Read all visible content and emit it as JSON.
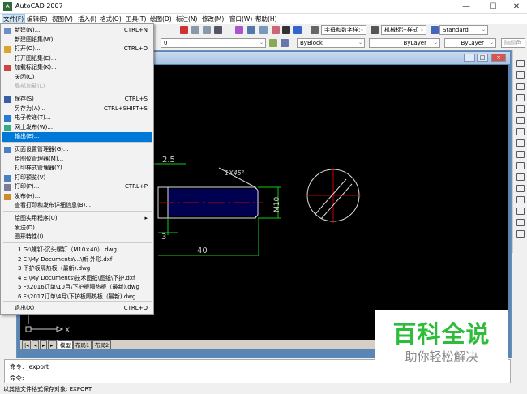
{
  "window": {
    "title": "AutoCAD 2007",
    "minimize": "—",
    "maximize": "☐",
    "close": "✕"
  },
  "menubar": [
    "文件(F)",
    "编辑(E)",
    "视图(V)",
    "插入(I)",
    "格式(O)",
    "工具(T)",
    "绘图(D)",
    "标注(N)",
    "修改(M)",
    "窗口(W)",
    "帮助(H)"
  ],
  "toolbar": {
    "layer": "0",
    "text_style": "字母和数字样:",
    "dim_style": "机械标注样式",
    "table_style": "Standard",
    "color": "ByBlock",
    "linetype": "ByLayer",
    "lineweight": "ByLayer",
    "plot_style": "随颜色"
  },
  "file_menu": {
    "items": [
      {
        "label": "新建(N)...",
        "shortcut": "CTRL+N"
      },
      {
        "label": "新建图纸集(W)...",
        "shortcut": ""
      },
      {
        "label": "打开(O)...",
        "shortcut": "CTRL+O"
      },
      {
        "label": "打开图纸集(E)...",
        "shortcut": ""
      },
      {
        "label": "加载标记集(K)...",
        "shortcut": ""
      },
      {
        "label": "关闭(C)",
        "shortcut": ""
      },
      {
        "label": "局部加载(L)",
        "shortcut": ""
      },
      {
        "label": "保存(S)",
        "shortcut": "CTRL+S"
      },
      {
        "label": "另存为(A)...",
        "shortcut": "CTRL+SHIFT+S"
      },
      {
        "label": "电子传递(T)...",
        "shortcut": ""
      },
      {
        "label": "网上发布(W)...",
        "shortcut": ""
      },
      {
        "label": "输出(E)...",
        "shortcut": ""
      },
      {
        "label": "页面设置管理器(G)...",
        "shortcut": ""
      },
      {
        "label": "绘图仪管理器(M)...",
        "shortcut": ""
      },
      {
        "label": "打印样式管理器(Y)...",
        "shortcut": ""
      },
      {
        "label": "打印预览(V)",
        "shortcut": ""
      },
      {
        "label": "打印(P)...",
        "shortcut": "CTRL+P"
      },
      {
        "label": "发布(H)...",
        "shortcut": ""
      },
      {
        "label": "查看打印和发布详细信息(B)...",
        "shortcut": ""
      },
      {
        "label": "绘图实用程序(U)",
        "shortcut": "▸"
      },
      {
        "label": "发送(D)...",
        "shortcut": ""
      },
      {
        "label": "图形特性(I)...",
        "shortcut": ""
      },
      {
        "label": "1 G:\\螺钉-沉头螺钉（M10×40）.dwg",
        "shortcut": ""
      },
      {
        "label": "2 E:\\My Documents\\...\\新-外形.dxf",
        "shortcut": ""
      },
      {
        "label": "3 下护板隔热板（最新).dwg",
        "shortcut": ""
      },
      {
        "label": "4 E:\\My Documents\\技术图纸\\图纸\\下护.dxf",
        "shortcut": ""
      },
      {
        "label": "5 F:\\2016订单\\10月\\下护板隔热板（最新).dwg",
        "shortcut": ""
      },
      {
        "label": "6 F:\\2017订单\\4月\\下护板隔热板（最新).dwg",
        "shortcut": ""
      },
      {
        "label": "退出(X)",
        "shortcut": "CTRL+Q"
      }
    ]
  },
  "drawing": {
    "dims": [
      "2.5",
      "1X45°",
      "M10",
      "3",
      "40"
    ],
    "ucs_x": "X"
  },
  "layout_tabs": [
    "模型",
    "布局1",
    "布局2"
  ],
  "command": {
    "line1": "命令: _export",
    "line2": "命令:"
  },
  "status": "以其他文件格式保存对象:  EXPORT",
  "watermark": {
    "title": "百科全说",
    "subtitle": "助你轻松解决"
  }
}
